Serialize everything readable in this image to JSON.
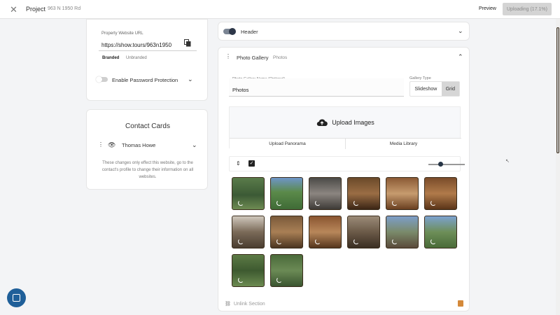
{
  "topbar": {
    "close_icon": "close-icon",
    "project_label": "Project",
    "address": "963 N 1950 Rd",
    "preview_label": "Preview",
    "uploading_label": "Uploading (17.1%)"
  },
  "website_card": {
    "url_label": "Property Website URL",
    "url_value": "https://show.tours/963n1950",
    "branded_label": "Branded",
    "unbranded_label": "Unbranded",
    "password_label": "Enable Password Protection"
  },
  "contact_card": {
    "title": "Contact Cards",
    "contact_name": "Thomas Howe",
    "note": "These changes only effect this website, go to the contact's profile to change their information on all websites."
  },
  "header_section": {
    "label": "Header"
  },
  "gallery_section": {
    "title": "Photo Gallery",
    "subtitle": "Photos",
    "name_label": "Photo Gallery Name (Optional)",
    "name_value": "Photos",
    "type_label": "Gallery Type",
    "type_options": [
      "Slideshow",
      "Grid"
    ],
    "selected_type": "Grid",
    "upload_label": "Upload Images",
    "upload_panorama_label": "Upload Panorama",
    "media_library_label": "Media Library",
    "unlink_label": "Unlink Section",
    "thumbnail_count": 14,
    "colors": {
      "accent": "#263445",
      "trash": "#d4893a"
    }
  },
  "chat": {
    "icon": "chat-icon",
    "color": "#1f5f99"
  }
}
